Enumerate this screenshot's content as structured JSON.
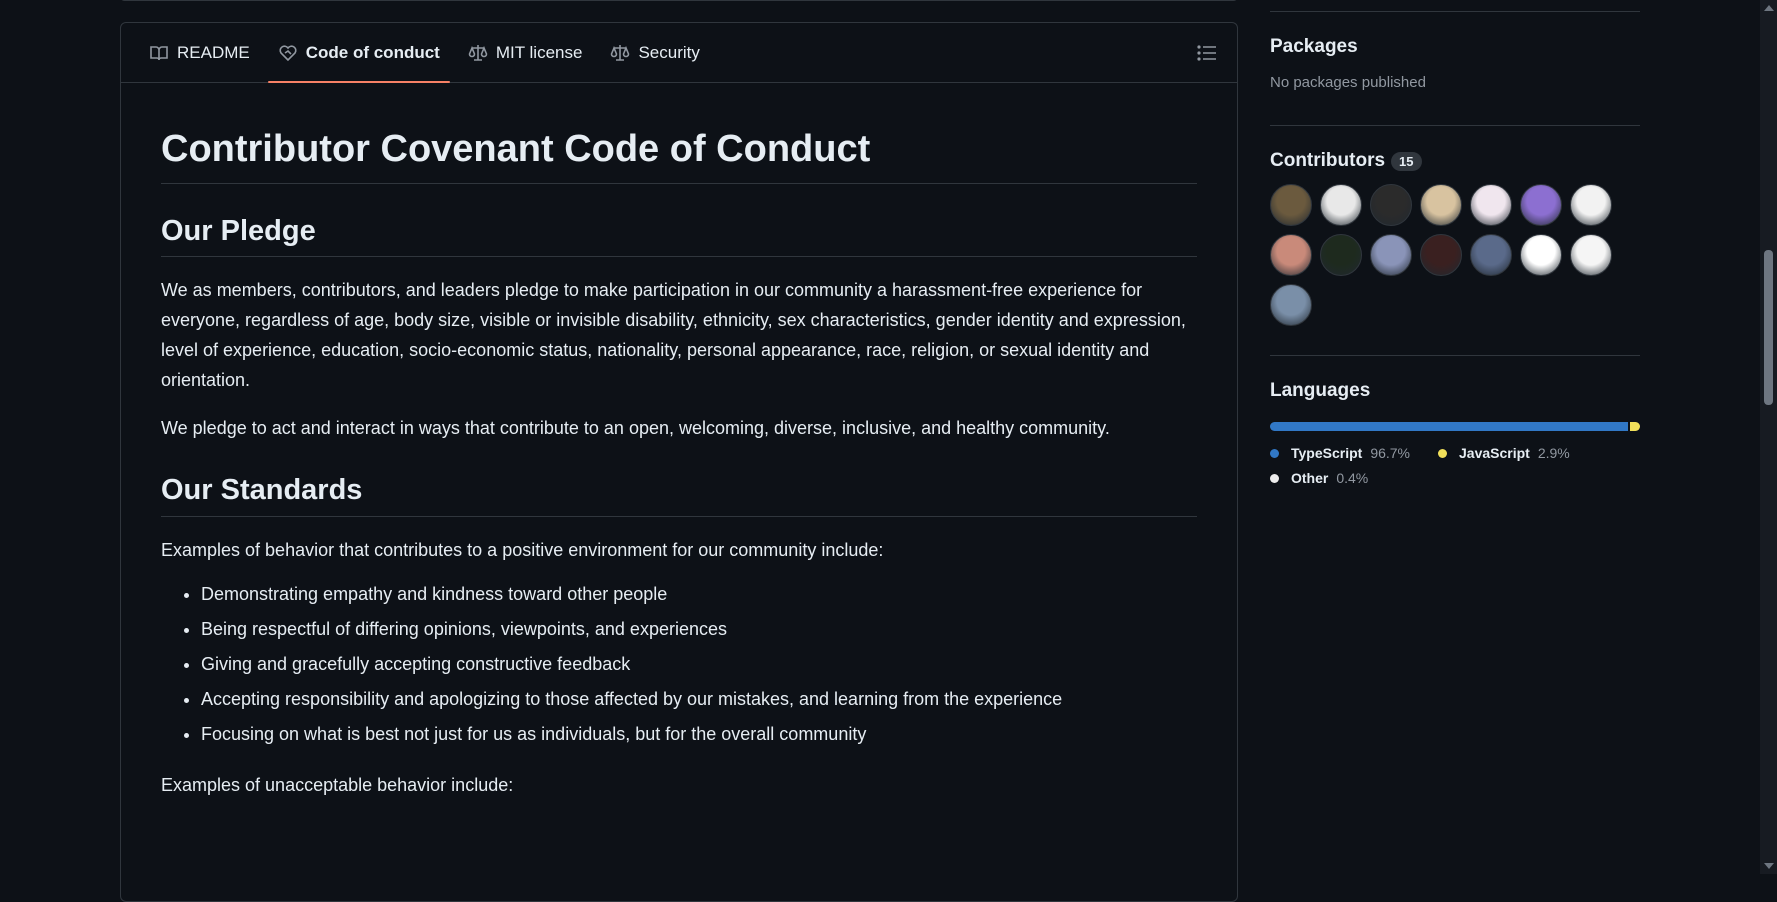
{
  "tabs": [
    {
      "label": "README",
      "icon": "book-icon"
    },
    {
      "label": "Code of conduct",
      "icon": "code-of-conduct-icon",
      "active": true
    },
    {
      "label": "MIT license",
      "icon": "law-icon"
    },
    {
      "label": "Security",
      "icon": "law-icon"
    }
  ],
  "readme": {
    "title": "Contributor Covenant Code of Conduct",
    "pledge_heading": "Our Pledge",
    "pledge_p1": "We as members, contributors, and leaders pledge to make participation in our community a harassment-free experience for everyone, regardless of age, body size, visible or invisible disability, ethnicity, sex characteristics, gender identity and expression, level of experience, education, socio-economic status, nationality, personal appearance, race, religion, or sexual identity and orientation.",
    "pledge_p2": "We pledge to act and interact in ways that contribute to an open, welcoming, diverse, inclusive, and healthy community.",
    "standards_heading": "Our Standards",
    "standards_intro": "Examples of behavior that contributes to a positive environment for our community include:",
    "standards_items": [
      "Demonstrating empathy and kindness toward other people",
      "Being respectful of differing opinions, viewpoints, and experiences",
      "Giving and gracefully accepting constructive feedback",
      "Accepting responsibility and apologizing to those affected by our mistakes, and learning from the experience",
      "Focusing on what is best not just for us as individuals, but for the overall community"
    ],
    "unacceptable_intro": "Examples of unacceptable behavior include:"
  },
  "sidebar": {
    "packages_title": "Packages",
    "packages_empty": "No packages published",
    "contributors_title": "Contributors",
    "contributors_count": "15",
    "avatar_colors": [
      "#6b5a3e",
      "#e8e8e8",
      "#2b2b2b",
      "#d8c3a0",
      "#f0e6ee",
      "#8c6fd1",
      "#f2f2f2",
      "#c98a7a",
      "#1e2a1e",
      "#8a94b8",
      "#3a2020",
      "#5a6a8a",
      "#ffffff",
      "#f5f5f5",
      "#7a8fa8"
    ],
    "languages_title": "Languages",
    "languages": [
      {
        "name": "TypeScript",
        "pct": "96.7%",
        "value": 96.7,
        "color": "#3178c6"
      },
      {
        "name": "JavaScript",
        "pct": "2.9%",
        "value": 2.9,
        "color": "#f1e05a"
      },
      {
        "name": "Other",
        "pct": "0.4%",
        "value": 0.4,
        "color": "#ededed"
      }
    ]
  }
}
